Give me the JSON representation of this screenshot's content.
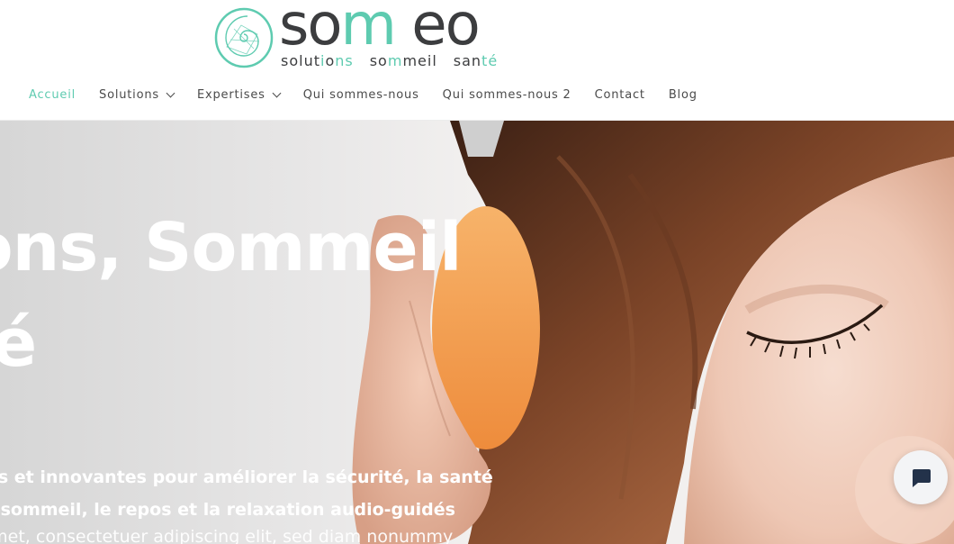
{
  "brand": {
    "wordmark": {
      "part1": "so",
      "part2": "m",
      "part3": " eo"
    },
    "tagline": {
      "w1a": "solut",
      "w1b": "i",
      "w1c": "o",
      "w1d": "ns",
      "w2a": "so",
      "w2b": "m",
      "w2c": "meil",
      "w3a": "san",
      "w3b": "t",
      "w3c": "é"
    },
    "accent_color": "#5ecbb0"
  },
  "nav": {
    "items": [
      {
        "label": "Accueil",
        "active": true
      },
      {
        "label": "Solutions",
        "dropdown": true
      },
      {
        "label": "Expertises",
        "dropdown": true
      },
      {
        "label": "Qui sommes-nous"
      },
      {
        "label": "Qui sommes-nous 2"
      },
      {
        "label": "Contact"
      },
      {
        "label": "Blog"
      }
    ]
  },
  "hero": {
    "title_line1": "tions, Sommeil",
    "title_line2": "nté",
    "subtitle_line1": "nnelles et innovantes pour améliorer la sécurité, la santé",
    "subtitle_line2": "our le sommeil, le repos et la relaxation audio-guidés",
    "body": "r sit amet, consectetuer adipiscing elit, sed diam nonummy"
  },
  "chat": {
    "icon": "chat-bubble-icon"
  }
}
